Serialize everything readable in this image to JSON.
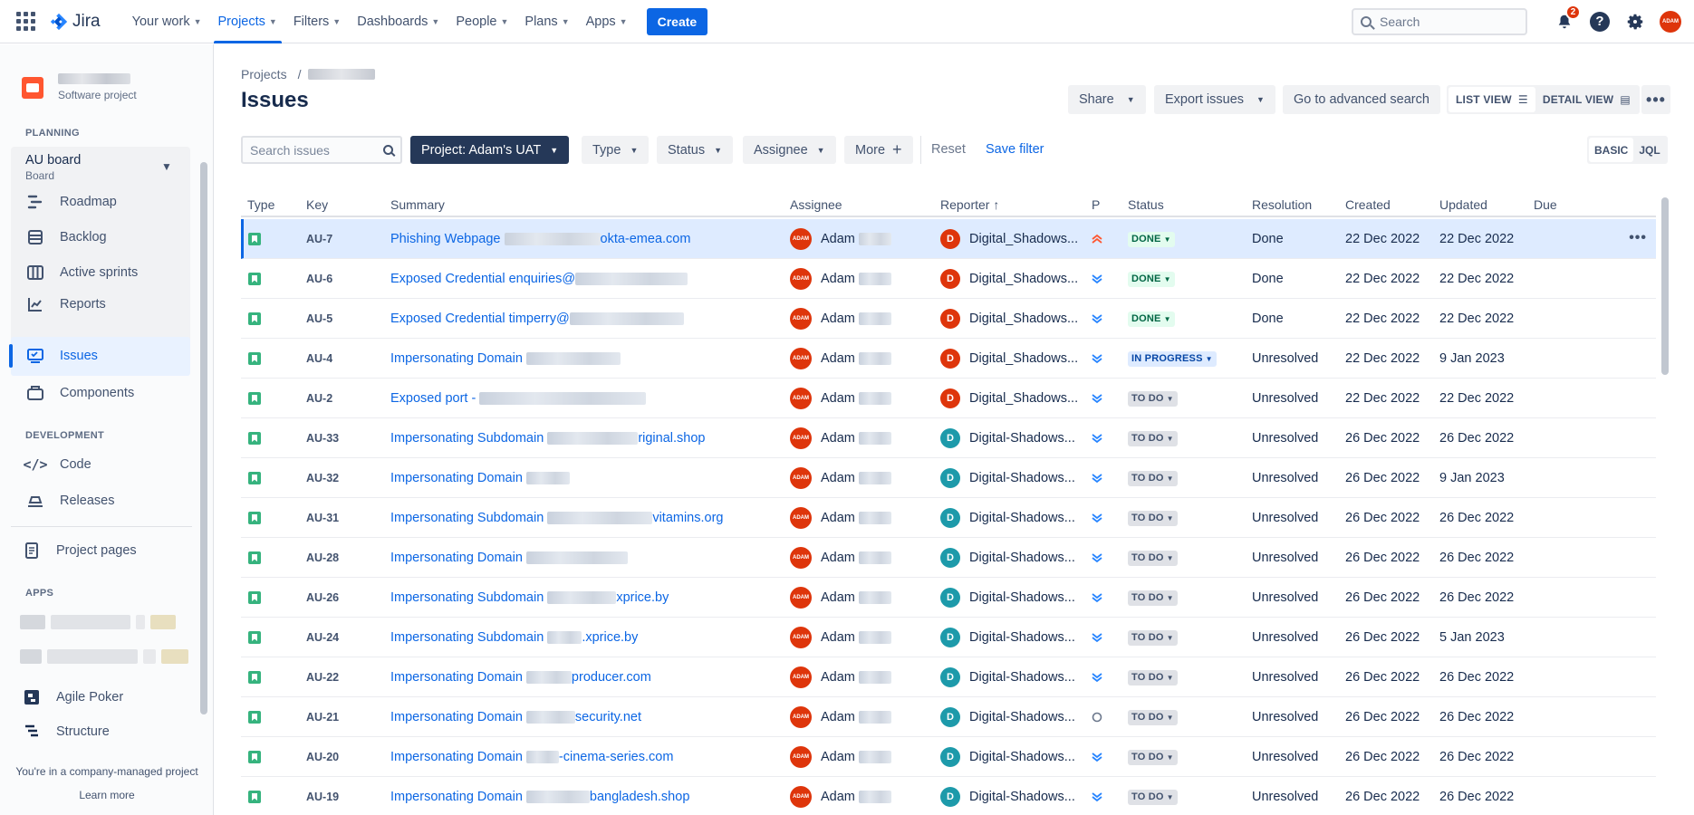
{
  "nav": {
    "logo": "Jira",
    "items": [
      {
        "label": "Your work",
        "active": false
      },
      {
        "label": "Projects",
        "active": true
      },
      {
        "label": "Filters",
        "active": false
      },
      {
        "label": "Dashboards",
        "active": false
      },
      {
        "label": "People",
        "active": false
      },
      {
        "label": "Plans",
        "active": false
      },
      {
        "label": "Apps",
        "active": false
      }
    ],
    "create_label": "Create",
    "search_placeholder": "Search",
    "notification_count": "2",
    "help_glyph": "?",
    "avatar_text": "ADAM"
  },
  "sidebar": {
    "project_type": "Software project",
    "planning_label": "PLANNING",
    "board_title": "AU board",
    "board_subtitle": "Board",
    "planning_items": [
      {
        "label": "Roadmap",
        "icon": "roadmap-icon"
      },
      {
        "label": "Backlog",
        "icon": "backlog-icon"
      },
      {
        "label": "Active sprints",
        "icon": "board-icon"
      },
      {
        "label": "Reports",
        "icon": "reports-icon"
      }
    ],
    "issues_label": "Issues",
    "components_label": "Components",
    "development_label": "DEVELOPMENT",
    "code_label": "Code",
    "releases_label": "Releases",
    "project_pages_label": "Project pages",
    "apps_label": "APPS",
    "agile_poker_label": "Agile Poker",
    "structure_label": "Structure",
    "footer_text": "You're in a company-managed project",
    "footer_link": "Learn more"
  },
  "main": {
    "breadcrumb_root": "Projects",
    "breadcrumb_sep": "/",
    "title": "Issues",
    "share_label": "Share",
    "export_label": "Export issues",
    "advanced_label": "Go to advanced search",
    "list_view_label": "LIST VIEW",
    "detail_view_label": "DETAIL VIEW",
    "search_placeholder": "Search issues",
    "project_filter": "Project: Adam's UAT",
    "type_filter": "Type",
    "status_filter": "Status",
    "assignee_filter": "Assignee",
    "more_filter": "More",
    "reset_label": "Reset",
    "save_filter_label": "Save filter",
    "basic_label": "BASIC",
    "jql_label": "JQL"
  },
  "table": {
    "headers": {
      "type": "Type",
      "key": "Key",
      "summary": "Summary",
      "assignee": "Assignee",
      "reporter": "Reporter",
      "reporter_sort": "↑",
      "p": "P",
      "status": "Status",
      "resolution": "Resolution",
      "created": "Created",
      "updated": "Updated",
      "due": "Due"
    },
    "rows": [
      {
        "key": "AU-7",
        "s1": "Phishing Webpage ",
        "s2": "okta-emea.com",
        "blur": 106,
        "assignee": "Adam",
        "reporter": "Digital_Shadows...",
        "rep_initial": "D",
        "rep_color": "#de350b",
        "priority": "highest",
        "status": "DONE",
        "status_kind": "done",
        "resolution": "Done",
        "created": "22 Dec 2022",
        "updated": "22 Dec 2022",
        "selected": true
      },
      {
        "key": "AU-6",
        "s1": "Exposed Credential enquiries@",
        "s2": "",
        "blur": 124,
        "assignee": "Adam",
        "reporter": "Digital_Shadows...",
        "rep_initial": "D",
        "rep_color": "#de350b",
        "priority": "lowest",
        "status": "DONE",
        "status_kind": "done",
        "resolution": "Done",
        "created": "22 Dec 2022",
        "updated": "22 Dec 2022",
        "selected": false
      },
      {
        "key": "AU-5",
        "s1": "Exposed Credential timperry@",
        "s2": "",
        "blur": 126,
        "assignee": "Adam",
        "reporter": "Digital_Shadows...",
        "rep_initial": "D",
        "rep_color": "#de350b",
        "priority": "lowest",
        "status": "DONE",
        "status_kind": "done",
        "resolution": "Done",
        "created": "22 Dec 2022",
        "updated": "22 Dec 2022",
        "selected": false
      },
      {
        "key": "AU-4",
        "s1": "Impersonating Domain ",
        "s2": "",
        "blur": 104,
        "assignee": "Adam",
        "reporter": "Digital_Shadows...",
        "rep_initial": "D",
        "rep_color": "#de350b",
        "priority": "lowest",
        "status": "IN PROGRESS",
        "status_kind": "prog",
        "resolution": "Unresolved",
        "created": "22 Dec 2022",
        "updated": "9 Jan 2023",
        "selected": false
      },
      {
        "key": "AU-2",
        "s1": "Exposed port - ",
        "s2": "",
        "blur": 184,
        "assignee": "Adam",
        "reporter": "Digital_Shadows...",
        "rep_initial": "D",
        "rep_color": "#de350b",
        "priority": "lowest",
        "status": "TO DO",
        "status_kind": "todo",
        "resolution": "Unresolved",
        "created": "22 Dec 2022",
        "updated": "22 Dec 2022",
        "selected": false
      },
      {
        "key": "AU-33",
        "s1": "Impersonating Subdomain ",
        "s2": "riginal.shop",
        "blur": 100,
        "assignee": "Adam",
        "reporter": "Digital-Shadows...",
        "rep_initial": "D",
        "rep_color": "#1d9aaa",
        "priority": "lowest",
        "status": "TO DO",
        "status_kind": "todo",
        "resolution": "Unresolved",
        "created": "26 Dec 2022",
        "updated": "26 Dec 2022",
        "selected": false
      },
      {
        "key": "AU-32",
        "s1": "Impersonating Domain ",
        "s2": "",
        "blur": 48,
        "assignee": "Adam",
        "reporter": "Digital-Shadows...",
        "rep_initial": "D",
        "rep_color": "#1d9aaa",
        "priority": "lowest",
        "status": "TO DO",
        "status_kind": "todo",
        "resolution": "Unresolved",
        "created": "26 Dec 2022",
        "updated": "9 Jan 2023",
        "selected": false
      },
      {
        "key": "AU-31",
        "s1": "Impersonating Subdomain ",
        "s2": "vitamins.org",
        "blur": 116,
        "assignee": "Adam",
        "reporter": "Digital-Shadows...",
        "rep_initial": "D",
        "rep_color": "#1d9aaa",
        "priority": "lowest",
        "status": "TO DO",
        "status_kind": "todo",
        "resolution": "Unresolved",
        "created": "26 Dec 2022",
        "updated": "26 Dec 2022",
        "selected": false
      },
      {
        "key": "AU-28",
        "s1": "Impersonating Domain ",
        "s2": "",
        "blur": 112,
        "assignee": "Adam",
        "reporter": "Digital-Shadows...",
        "rep_initial": "D",
        "rep_color": "#1d9aaa",
        "priority": "lowest",
        "status": "TO DO",
        "status_kind": "todo",
        "resolution": "Unresolved",
        "created": "26 Dec 2022",
        "updated": "26 Dec 2022",
        "selected": false
      },
      {
        "key": "AU-26",
        "s1": "Impersonating Subdomain ",
        "s2": "xprice.by",
        "blur": 76,
        "assignee": "Adam",
        "reporter": "Digital-Shadows...",
        "rep_initial": "D",
        "rep_color": "#1d9aaa",
        "priority": "lowest",
        "status": "TO DO",
        "status_kind": "todo",
        "resolution": "Unresolved",
        "created": "26 Dec 2022",
        "updated": "26 Dec 2022",
        "selected": false
      },
      {
        "key": "AU-24",
        "s1": "Impersonating Subdomain ",
        "s2": ".xprice.by",
        "blur": 38,
        "assignee": "Adam",
        "reporter": "Digital-Shadows...",
        "rep_initial": "D",
        "rep_color": "#1d9aaa",
        "priority": "lowest",
        "status": "TO DO",
        "status_kind": "todo",
        "resolution": "Unresolved",
        "created": "26 Dec 2022",
        "updated": "5 Jan 2023",
        "selected": false
      },
      {
        "key": "AU-22",
        "s1": "Impersonating Domain ",
        "s2": "producer.com",
        "blur": 50,
        "assignee": "Adam",
        "reporter": "Digital-Shadows...",
        "rep_initial": "D",
        "rep_color": "#1d9aaa",
        "priority": "lowest",
        "status": "TO DO",
        "status_kind": "todo",
        "resolution": "Unresolved",
        "created": "26 Dec 2022",
        "updated": "26 Dec 2022",
        "selected": false
      },
      {
        "key": "AU-21",
        "s1": "Impersonating Domain ",
        "s2": "security.net",
        "blur": 54,
        "assignee": "Adam",
        "reporter": "Digital-Shadows...",
        "rep_initial": "D",
        "rep_color": "#1d9aaa",
        "priority": "none",
        "status": "TO DO",
        "status_kind": "todo",
        "resolution": "Unresolved",
        "created": "26 Dec 2022",
        "updated": "26 Dec 2022",
        "selected": false
      },
      {
        "key": "AU-20",
        "s1": "Impersonating Domain ",
        "s2": "-cinema-series.com",
        "blur": 36,
        "assignee": "Adam",
        "reporter": "Digital-Shadows...",
        "rep_initial": "D",
        "rep_color": "#1d9aaa",
        "priority": "lowest",
        "status": "TO DO",
        "status_kind": "todo",
        "resolution": "Unresolved",
        "created": "26 Dec 2022",
        "updated": "26 Dec 2022",
        "selected": false
      },
      {
        "key": "AU-19",
        "s1": "Impersonating Domain ",
        "s2": "bangladesh.shop",
        "blur": 70,
        "assignee": "Adam",
        "reporter": "Digital-Shadows...",
        "rep_initial": "D",
        "rep_color": "#1d9aaa",
        "priority": "lowest",
        "status": "TO DO",
        "status_kind": "todo",
        "resolution": "Unresolved",
        "created": "26 Dec 2022",
        "updated": "26 Dec 2022",
        "selected": false
      }
    ]
  },
  "colors": {
    "accent": "#0c66e4",
    "done": "#006644",
    "in_progress": "#0747a6",
    "todo": "#42526e",
    "highest": "#ff5630",
    "lowest": "#2684ff"
  }
}
